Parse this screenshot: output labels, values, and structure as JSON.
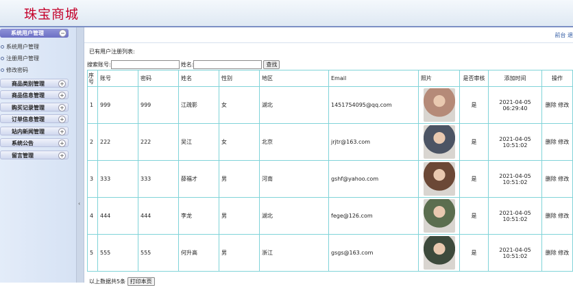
{
  "app": {
    "logo": "珠宝商城"
  },
  "nav": {
    "right_link": "前台 退"
  },
  "sidebar": {
    "groups": [
      {
        "label": "系统用户管理",
        "toggle": "−",
        "expanded": true
      },
      {
        "label": "商品类别管理",
        "toggle": "+"
      },
      {
        "label": "商品信息管理",
        "toggle": "+"
      },
      {
        "label": "购买记录管理",
        "toggle": "+"
      },
      {
        "label": "订单信息管理",
        "toggle": "+"
      },
      {
        "label": "站内新闻管理",
        "toggle": "+"
      },
      {
        "label": "系统公告",
        "toggle": "+"
      },
      {
        "label": "留言管理",
        "toggle": "+"
      }
    ],
    "sub_items": [
      "系统用户管理",
      "注册用户管理",
      "修改密码"
    ],
    "splitter_arrow": "‹"
  },
  "main": {
    "list_title": "已有用户注册列表:",
    "search": {
      "account_label": "搜索账号:",
      "name_label": "姓名:",
      "account_value": "",
      "name_value": "",
      "button": "查找"
    },
    "columns": [
      "序号",
      "账号",
      "密码",
      "姓名",
      "性别",
      "地区",
      "Email",
      "照片",
      "是否审核",
      "添加时间",
      "操作"
    ],
    "rows": [
      {
        "no": "1",
        "account": "999",
        "password": "999",
        "name": "江疏影",
        "gender": "女",
        "region": "湖北",
        "email": "1451754095@qq.com",
        "approved": "是",
        "date": "2021-04-05",
        "time": "06:29:40",
        "del": "删除",
        "edit": "修改"
      },
      {
        "no": "2",
        "account": "222",
        "password": "222",
        "name": "吴江",
        "gender": "女",
        "region": "北京",
        "email": "jrjtr@163.com",
        "approved": "是",
        "date": "2021-04-05",
        "time": "10:51:02",
        "del": "删除",
        "edit": "修改"
      },
      {
        "no": "3",
        "account": "333",
        "password": "333",
        "name": "薛福才",
        "gender": "男",
        "region": "河南",
        "email": "gshf@yahoo.com",
        "approved": "是",
        "date": "2021-04-05",
        "time": "10:51:02",
        "del": "删除",
        "edit": "修改"
      },
      {
        "no": "4",
        "account": "444",
        "password": "444",
        "name": "李龙",
        "gender": "男",
        "region": "湖北",
        "email": "fege@126.com",
        "approved": "是",
        "date": "2021-04-05",
        "time": "10:51:02",
        "del": "删除",
        "edit": "修改"
      },
      {
        "no": "5",
        "account": "555",
        "password": "555",
        "name": "何升高",
        "gender": "男",
        "region": "浙江",
        "email": "gsgs@163.com",
        "approved": "是",
        "date": "2021-04-05",
        "time": "10:51:02",
        "del": "删除",
        "edit": "修改"
      }
    ],
    "photo_colors": [
      "#b58a78",
      "#4c5464",
      "#6b4836",
      "#5b6e4f",
      "#3d4a3c"
    ],
    "footer": {
      "text": "以上数据共5条",
      "button": "打印本页"
    }
  }
}
